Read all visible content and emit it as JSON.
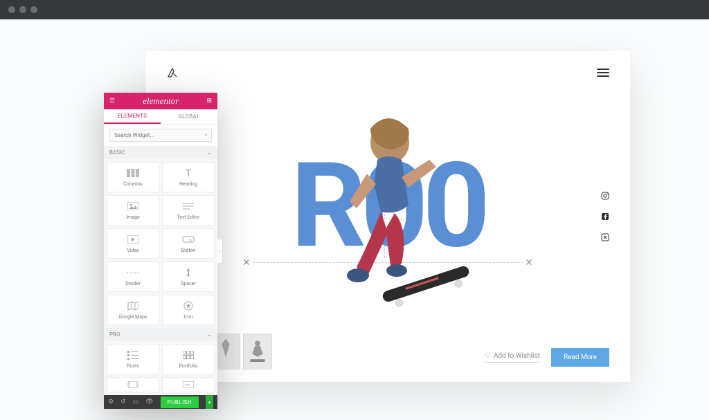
{
  "panel": {
    "brand": "elementor",
    "tabs": {
      "elements": "ELEMENTS",
      "global": "GLOBAL"
    },
    "search_placeholder": "Search Widget...",
    "sections": {
      "basic": {
        "title": "BASIC",
        "widgets": [
          {
            "name": "columns",
            "label": "Columns"
          },
          {
            "name": "heading",
            "label": "Heading"
          },
          {
            "name": "image",
            "label": "Image"
          },
          {
            "name": "text-editor",
            "label": "Text Editor"
          },
          {
            "name": "video",
            "label": "Video"
          },
          {
            "name": "button",
            "label": "Button"
          },
          {
            "name": "divider",
            "label": "Divider"
          },
          {
            "name": "spacer",
            "label": "Spacer"
          },
          {
            "name": "google-maps",
            "label": "Google Maps"
          },
          {
            "name": "icon",
            "label": "Icon"
          }
        ]
      },
      "pro": {
        "title": "PRO",
        "widgets": [
          {
            "name": "posts",
            "label": "Posts"
          },
          {
            "name": "portfolio",
            "label": "Portfolio"
          },
          {
            "name": "slides",
            "label": ""
          },
          {
            "name": "form",
            "label": ""
          }
        ]
      }
    },
    "publish_label": "PUBLISH"
  },
  "canvas": {
    "hero_text": "R00",
    "wishlist_label": "Add to Wishlist",
    "readmore_label": "Read More"
  },
  "colors": {
    "accent": "#d6236a",
    "hero_blue": "#5a8fd6",
    "cta_blue": "#5fa8e8",
    "publish_green": "#2ecc40"
  }
}
